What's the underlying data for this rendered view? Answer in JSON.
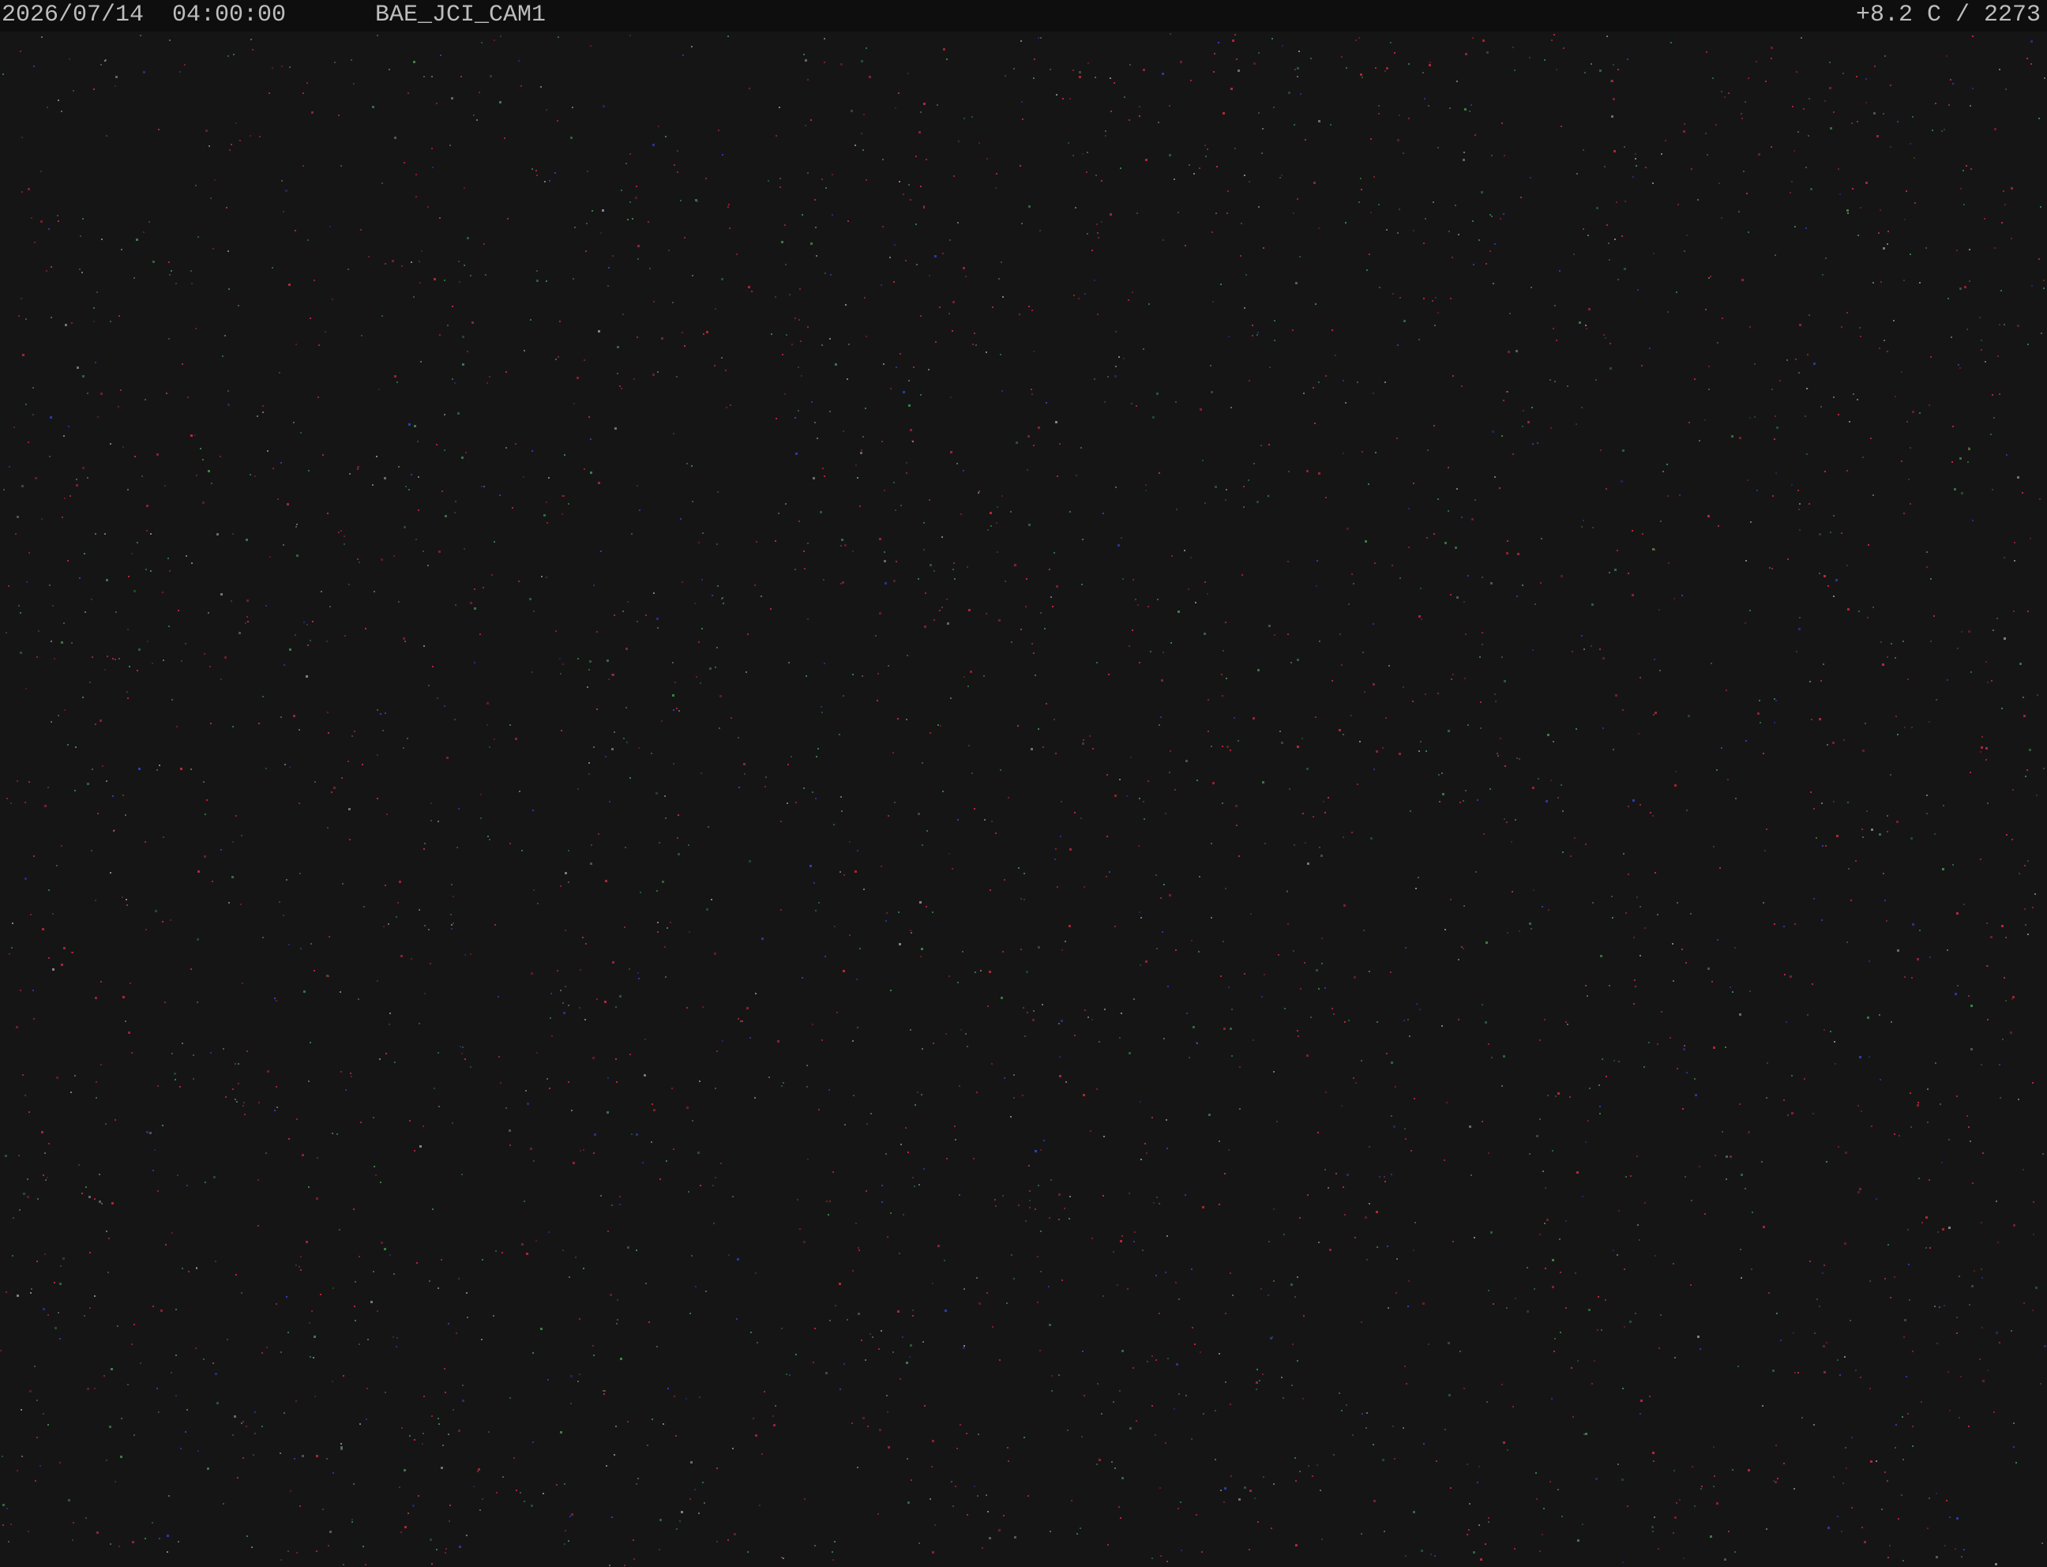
{
  "overlay": {
    "timestamp": "2026/07/14  04:00:00",
    "camera_id": "BAE_JCI_CAM1",
    "sensor_readout": "+8.2 C / 2273"
  },
  "colors": {
    "background": "#151516",
    "osd_bar": "#0e0e0f",
    "osd_text": "#bdbdbd",
    "noise": [
      "#c4283a",
      "#3a8a4a",
      "#3340c0",
      "#8a8a8a"
    ]
  }
}
